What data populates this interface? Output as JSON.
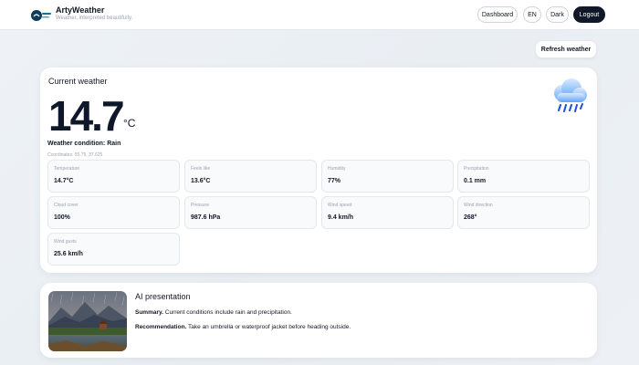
{
  "header": {
    "title": "ArtyWeather",
    "subtitle": "Weather, interpreted beautifully.",
    "logo_icon": "cloud-logo-icon",
    "nav": {
      "dashboard": "Dashboard",
      "language": "EN",
      "theme": "Dark",
      "logout": "Logout"
    }
  },
  "actions": {
    "refresh_label": "Refresh weather"
  },
  "current": {
    "heading": "Current weather",
    "temperature": "14.7",
    "unit": "°C",
    "condition": "Weather condition: Rain",
    "coordinates": "Coordinates: 55.75, 37.625",
    "icon": "rain-cloud-icon"
  },
  "metrics": [
    {
      "label": "Temperature",
      "value": "14.7°C"
    },
    {
      "label": "Feels like",
      "value": "13.6°C"
    },
    {
      "label": "Humidity",
      "value": "77%"
    },
    {
      "label": "Precipitation",
      "value": "0.1 mm"
    },
    {
      "label": "Cloud cover",
      "value": "100%"
    },
    {
      "label": "Pressure",
      "value": "987.6 hPa"
    },
    {
      "label": "Wind speed",
      "value": "9.4 km/h"
    },
    {
      "label": "Wind direction",
      "value": "268°"
    },
    {
      "label": "Wind gusts",
      "value": "25.6 km/h"
    }
  ],
  "ai": {
    "heading": "AI presentation",
    "summary_label": "Summary.",
    "summary_text": " Current conditions include rain and precipitation.",
    "recommendation_label": "Recommendation.",
    "recommendation_text": " Take an umbrella or waterproof jacket before heading outside.",
    "image_icon": "rainy-lake-mountains-illustration"
  },
  "colors": {
    "accent_dark": "#111827",
    "card_bg": "#ffffff",
    "metric_bg": "#f9fafb",
    "page_bg": "#eef2f6"
  }
}
